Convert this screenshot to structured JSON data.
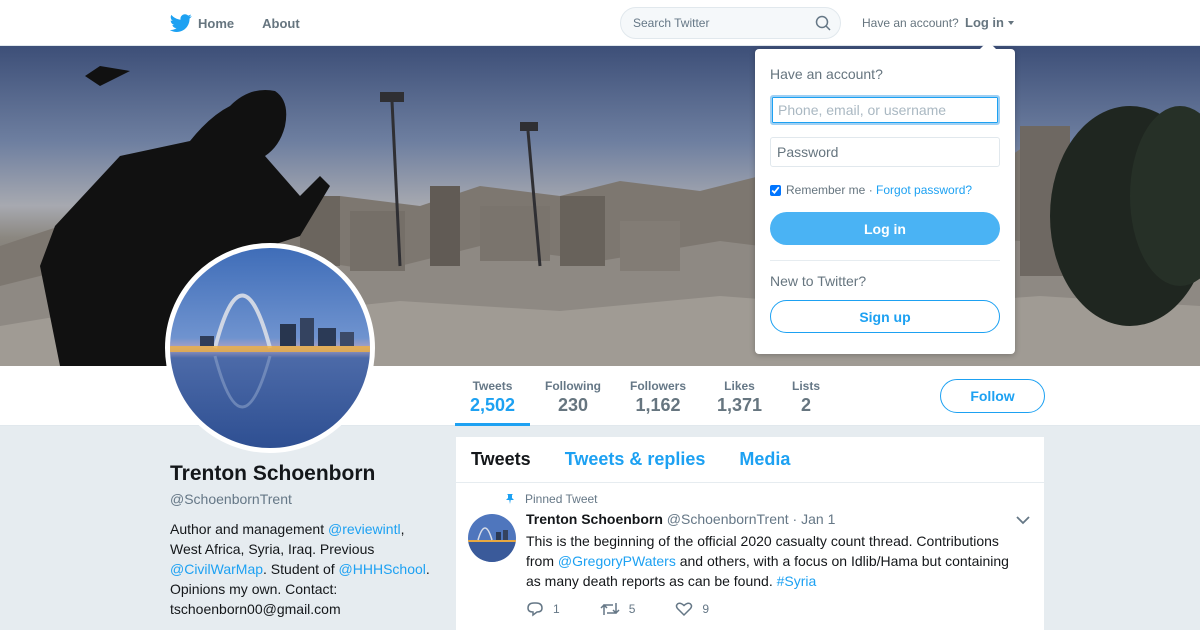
{
  "nav": {
    "home_label": "Home",
    "about_label": "About",
    "search_placeholder": "Search Twitter",
    "have_account": "Have an account?",
    "login_label": "Log in"
  },
  "profile": {
    "display_name": "Trenton Schoenborn",
    "handle": "@SchoenbornTrent",
    "bio": {
      "part1": "Author and management ",
      "mention1": "@reviewintl",
      "part2": ", West Africa, Syria, Iraq. Previous ",
      "mention2": "@CivilWarMap",
      "part3": ". Student of ",
      "mention3": "@HHHSchool",
      "part4": ". Opinions my own. Contact: tschoenborn00@gmail.com"
    }
  },
  "stats": [
    {
      "label": "Tweets",
      "value": "2,502"
    },
    {
      "label": "Following",
      "value": "230"
    },
    {
      "label": "Followers",
      "value": "1,162"
    },
    {
      "label": "Likes",
      "value": "1,371"
    },
    {
      "label": "Lists",
      "value": "2"
    }
  ],
  "follow_label": "Follow",
  "tabs": [
    "Tweets",
    "Tweets & replies",
    "Media"
  ],
  "tweet": {
    "pinned_label": "Pinned Tweet",
    "name": "Trenton Schoenborn",
    "handle": "@SchoenbornTrent",
    "separator": "·",
    "date": "Jan 1",
    "text_part1": "This is the beginning of the official 2020 casualty count thread. Contributions from ",
    "text_mention": "@GregoryPWaters",
    "text_part2": " and others, with a focus on Idlib/Hama but containing as many death reports as can be found. ",
    "text_hashtag": "#Syria",
    "replies": "1",
    "retweets": "5",
    "likes": "9"
  },
  "login_dropdown": {
    "heading": "Have an account?",
    "username_placeholder": "Phone, email, or username",
    "password_placeholder": "Password",
    "remember_label": "Remember me",
    "separator": " · ",
    "forgot_label": "Forgot password?",
    "login_button": "Log in",
    "new_heading": "New to Twitter?",
    "signup_button": "Sign up"
  },
  "colors": {
    "accent": "#1da1f2",
    "background": "#e6ecf0",
    "login_button": "#4ab3f4"
  }
}
